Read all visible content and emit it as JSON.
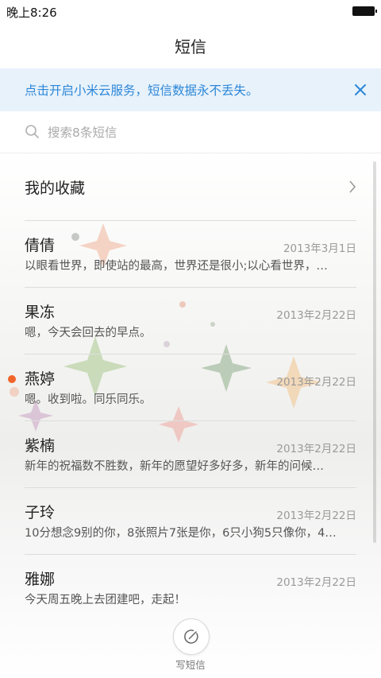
{
  "status_bar": {
    "time": "晚上8:26"
  },
  "header": {
    "title": "短信"
  },
  "banner": {
    "text": "点击开启小米云服务，短信数据永不丢失。"
  },
  "search": {
    "placeholder": "搜索8条短信"
  },
  "favorites": {
    "label": "我的收藏"
  },
  "conversations": [
    {
      "name": "倩倩",
      "date": "2013年3月1日",
      "preview": "以眼看世界，即使站的最高，世界还是很小;以心看世界，…",
      "unread": false
    },
    {
      "name": "果冻",
      "date": "2013年2月22日",
      "preview": "嗯，今天会回去的早点。",
      "unread": false
    },
    {
      "name": "燕婷",
      "date": "2013年2月22日",
      "preview": "嗯。收到啦。同乐同乐。",
      "unread": true
    },
    {
      "name": "紫楠",
      "date": "2013年2月22日",
      "preview": "新年的祝福数不胜数，新年的愿望好多好多，新年的问候…",
      "unread": false
    },
    {
      "name": "子玲",
      "date": "2013年2月22日",
      "preview": "10分想念9别的你，8张照片7张是你，6只小狗5只像你，4…",
      "unread": false
    },
    {
      "name": "雅娜",
      "date": "2013年2月22日",
      "preview": "今天周五晚上去团建吧，走起！",
      "unread": false
    }
  ],
  "compose": {
    "label": "写短信"
  },
  "colors": {
    "accent": "#2d87d8",
    "banner_bg": "#e8f2fb",
    "unread": "#f0652a"
  },
  "icons": {
    "banner_close": "close-icon",
    "search": "search-icon",
    "favorites": "chevron-right-icon",
    "compose": "compose-icon"
  }
}
